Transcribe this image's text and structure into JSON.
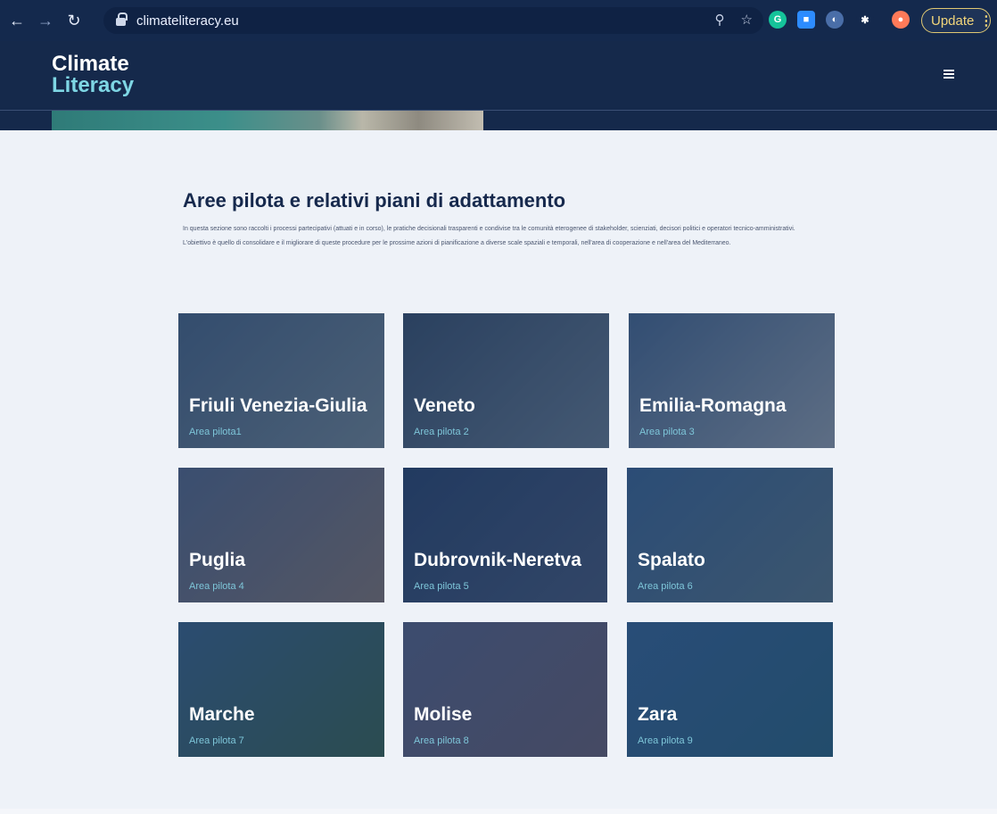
{
  "browser": {
    "url": "climateliteracy.eu",
    "update_label": "Update",
    "extensions": [
      {
        "name": "grammarly",
        "label": "G",
        "color": "#15c39a"
      },
      {
        "name": "zoom",
        "label": "■",
        "color": "#2d8cff"
      },
      {
        "name": "extension-a",
        "label": "◐",
        "color": "#4a6ea8"
      },
      {
        "name": "puzzle",
        "label": "✱",
        "color": "#14294d"
      },
      {
        "name": "profile",
        "label": "●",
        "color": "#ff7a59"
      }
    ]
  },
  "header": {
    "logo_line1": "Climate",
    "logo_line2": "Literacy"
  },
  "section": {
    "title": "Aree pilota e relativi piani di adattamento",
    "paragraph1": "In questa sezione sono raccolti i processi partecipativi (attuati e in corso), le  pratiche decisionali trasparenti e condivise tra le comunità eterogenee di stakeholder, scienziati, decisori politici e operatori tecnico-amministrativi.",
    "paragraph2": "L'obiettivo è quello di consolidare e il migliorare di queste procedure per le prossime azioni di pianificazione a diverse scale spaziali e temporali, nell'area di cooperazione e nell'area del Mediterraneo."
  },
  "cards": [
    {
      "name": "Friuli Venezia-Giulia",
      "sub": "Area pilota1",
      "c1": "#4d6b8a",
      "c2": "#7b8f9a"
    },
    {
      "name": "Veneto",
      "sub": "Area pilota 2",
      "c1": "#3d5570",
      "c2": "#6d8294"
    },
    {
      "name": "Emilia-Romagna",
      "sub": "Area pilota 3",
      "c1": "#4b6d93",
      "c2": "#9aa7b3"
    },
    {
      "name": "Puglia",
      "sub": "Area pilota 4",
      "c1": "#5a6e8e",
      "c2": "#8a7d78"
    },
    {
      "name": "Dubrovnik-Neretva",
      "sub": "Area pilota 5",
      "c1": "#2e4a72",
      "c2": "#4b5f7e"
    },
    {
      "name": "Spalato",
      "sub": "Area pilota 6",
      "c1": "#3f6b99",
      "c2": "#5d7c8c"
    },
    {
      "name": "Marche",
      "sub": "Area pilota 7",
      "c1": "#3e6b8f",
      "c2": "#3f6b55"
    },
    {
      "name": "Molise",
      "sub": "Area pilota 8",
      "c1": "#5e6a8c",
      "c2": "#6e6677"
    },
    {
      "name": "Zara",
      "sub": "Area pilota 9",
      "c1": "#3a6c9c",
      "c2": "#2f6a86"
    }
  ]
}
